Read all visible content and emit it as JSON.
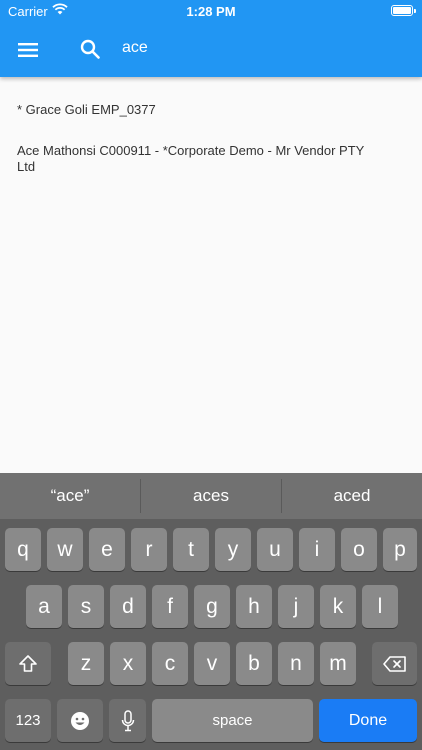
{
  "status": {
    "carrier": "Carrier",
    "time": "1:28 PM"
  },
  "search": {
    "value": "ace"
  },
  "results": [
    {
      "line1": "* Grace Goli EMP_0377",
      "line2": ""
    },
    {
      "line1": "Ace Mathonsi C000911 - *Corporate Demo - Mr Vendor PTY",
      "line2": "Ltd"
    }
  ],
  "keyboard": {
    "suggestions": [
      "“ace”",
      "aces",
      "aced"
    ],
    "row1": [
      "q",
      "w",
      "e",
      "r",
      "t",
      "y",
      "u",
      "i",
      "o",
      "p"
    ],
    "row2": [
      "a",
      "s",
      "d",
      "f",
      "g",
      "h",
      "j",
      "k",
      "l"
    ],
    "row3": [
      "z",
      "x",
      "c",
      "v",
      "b",
      "n",
      "m"
    ],
    "num_label": "123",
    "space_label": "space",
    "done_label": "Done"
  },
  "icons": {
    "menu": "menu-icon",
    "search": "search-icon",
    "shift": "shift-icon",
    "backspace": "backspace-icon",
    "emoji": "emoji-icon",
    "mic": "microphone-icon",
    "wifi": "wifi-icon",
    "battery": "battery-icon"
  },
  "colors": {
    "appbar": "#2196f3",
    "done": "#1a7cf5",
    "keyboard": "#5e5e5e"
  }
}
